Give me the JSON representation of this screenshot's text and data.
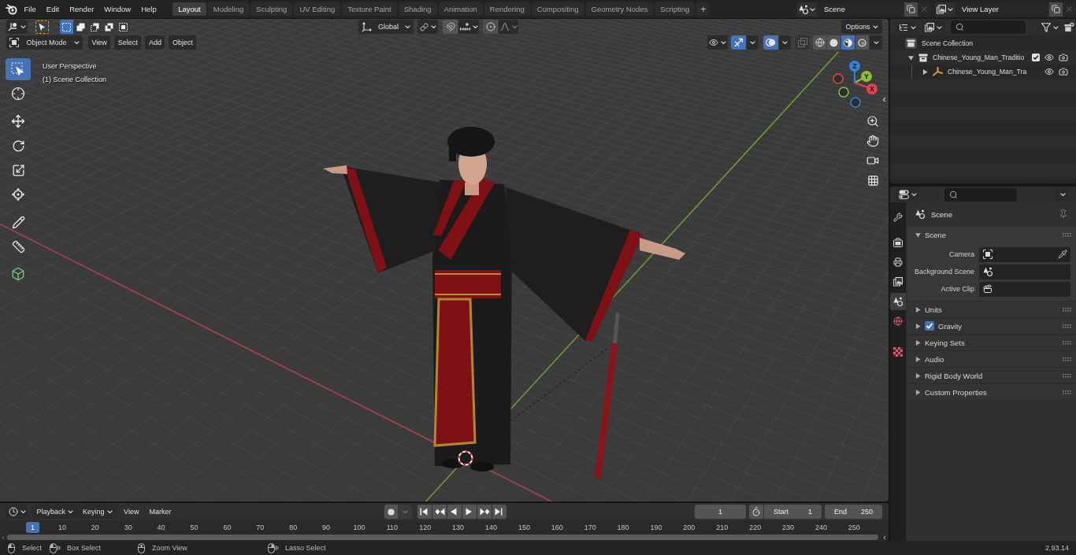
{
  "top_bar": {
    "menus": [
      "File",
      "Edit",
      "Render",
      "Window",
      "Help"
    ],
    "workspaces": [
      {
        "label": "Layout",
        "selected": true
      },
      {
        "label": "Modeling",
        "selected": false
      },
      {
        "label": "Sculpting",
        "selected": false
      },
      {
        "label": "UV Editing",
        "selected": false
      },
      {
        "label": "Texture Paint",
        "selected": false
      },
      {
        "label": "Shading",
        "selected": false
      },
      {
        "label": "Animation",
        "selected": false
      },
      {
        "label": "Rendering",
        "selected": false
      },
      {
        "label": "Compositing",
        "selected": false
      },
      {
        "label": "Geometry Nodes",
        "selected": false
      },
      {
        "label": "Scripting",
        "selected": false
      }
    ],
    "add_workspace": "+",
    "scene": "Scene",
    "view_layer": "View Layer"
  },
  "viewport": {
    "header": {
      "select_modes": [
        {
          "kind": "set",
          "selected": true
        },
        {
          "kind": "extend",
          "selected": false
        },
        {
          "kind": "subtract",
          "selected": false
        },
        {
          "kind": "invert",
          "selected": false
        },
        {
          "kind": "intersect",
          "selected": false
        }
      ],
      "orientation": "Global",
      "options": "Options",
      "mode": "Object Mode",
      "menus": [
        "View",
        "Select",
        "Add",
        "Object"
      ],
      "gizmos_on": true,
      "overlays_on": true,
      "xray_on": false,
      "shading_modes": [
        {
          "kind": "wireframe",
          "selected": false
        },
        {
          "kind": "solid",
          "selected": false
        },
        {
          "kind": "material",
          "selected": true
        },
        {
          "kind": "rendered",
          "selected": false
        }
      ]
    },
    "toolbar": {
      "groups": [
        {
          "tools": [
            {
              "kind": "select",
              "selected": true
            },
            {
              "kind": "cursor",
              "selected": false
            }
          ]
        },
        {
          "tools": [
            {
              "kind": "move",
              "selected": false
            },
            {
              "kind": "rotate",
              "selected": false
            },
            {
              "kind": "scale",
              "selected": false
            },
            {
              "kind": "transform",
              "selected": false
            }
          ]
        },
        {
          "tools": [
            {
              "kind": "annotate",
              "selected": false
            },
            {
              "kind": "measure",
              "selected": false
            }
          ]
        },
        {
          "tools": [
            {
              "kind": "add",
              "selected": false
            }
          ]
        }
      ]
    },
    "info": [
      "User Perspective",
      "(1) Scene Collection"
    ],
    "gizmo_axes": [
      {
        "label": "Z",
        "color": "#2f83e6"
      },
      {
        "label": "Y",
        "color": "#8bc233"
      },
      {
        "label": "X",
        "color": "#e5424f"
      }
    ]
  },
  "outliner": {
    "root": "Scene Collection",
    "items": [
      {
        "label": "Chinese_Young_Man_Traditio",
        "kind": "collection",
        "expanded": true,
        "checked": true,
        "children": [
          {
            "label": "Chinese_Young_Man_Tra",
            "kind": "armature",
            "expanded": false
          }
        ]
      }
    ]
  },
  "properties": {
    "tab_groups": [
      {
        "tabs": [
          {
            "kind": "tool",
            "selected": false
          }
        ]
      },
      {
        "tabs": [
          {
            "kind": "render",
            "selected": false
          },
          {
            "kind": "output",
            "selected": false
          },
          {
            "kind": "viewlayer",
            "selected": false
          },
          {
            "kind": "scene",
            "selected": true
          },
          {
            "kind": "world",
            "selected": false
          }
        ]
      },
      {
        "tabs": [
          {
            "kind": "texture",
            "selected": false
          }
        ]
      }
    ],
    "context": "Scene",
    "panels": [
      {
        "label": "Scene",
        "expanded": true,
        "fields": [
          {
            "label": "Camera",
            "kind": "camera"
          },
          {
            "label": "Background Scene",
            "kind": "scene"
          },
          {
            "label": "Active Clip",
            "kind": "clip"
          }
        ]
      },
      {
        "label": "Units",
        "expanded": false
      },
      {
        "label": "Gravity",
        "expanded": false,
        "checkbox": {
          "checked": true
        }
      },
      {
        "label": "Keying Sets",
        "expanded": false
      },
      {
        "label": "Audio",
        "expanded": false
      },
      {
        "label": "Rigid Body World",
        "expanded": false
      },
      {
        "label": "Custom Properties",
        "expanded": false
      }
    ]
  },
  "timeline": {
    "menus": [
      {
        "kind": "dropdown",
        "label": "Playback"
      },
      {
        "kind": "dropdown",
        "label": "Keying"
      },
      {
        "kind": "menu",
        "label": "View"
      },
      {
        "kind": "menu",
        "label": "Marker"
      }
    ],
    "auto_keying_on": false,
    "current_frame": "1",
    "start": {
      "label": "Start",
      "value": "1"
    },
    "end": {
      "label": "End",
      "value": "250"
    },
    "playhead": "1",
    "frame_labels": [
      "10",
      "20",
      "30",
      "40",
      "50",
      "60",
      "70",
      "80",
      "90",
      "100",
      "110",
      "120",
      "130",
      "140",
      "150",
      "160",
      "170",
      "180",
      "190",
      "200",
      "210",
      "220",
      "230",
      "240",
      "250"
    ]
  },
  "status_bar": {
    "hints": [
      {
        "kind": "click",
        "label": "Select"
      },
      {
        "kind": "drag",
        "label": "Box Select"
      },
      {
        "kind": "middle",
        "label": "Zoom View"
      },
      {
        "kind": "rightdrag",
        "label": "Lasso Select"
      }
    ],
    "version": "2.93.14"
  }
}
